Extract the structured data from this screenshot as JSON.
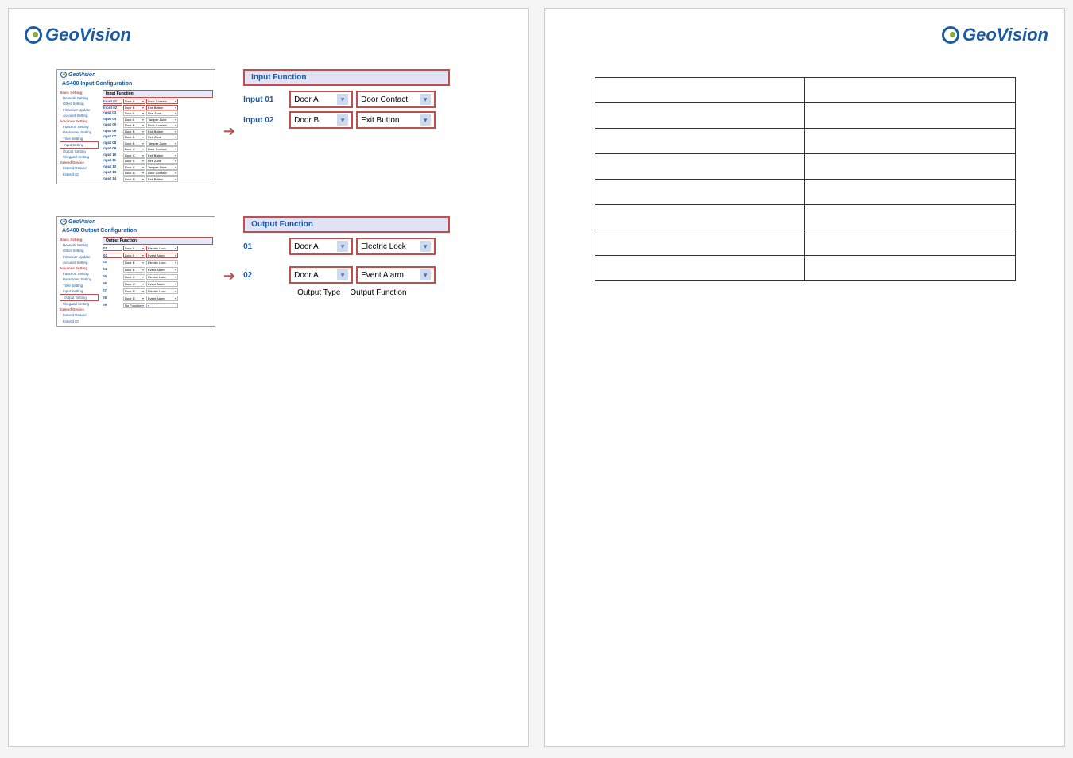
{
  "brand": "GeoVision",
  "input": {
    "mini_title": "AS400 Input Configuration",
    "panel_title": "Input Function",
    "rows": [
      {
        "n": "01",
        "door": "Door A",
        "fn": "Door Contact"
      },
      {
        "n": "02",
        "door": "Door B",
        "fn": "Exit Button"
      },
      {
        "n": "03",
        "door": "Door A",
        "fn": "Fire Zone"
      },
      {
        "n": "04",
        "door": "Door A",
        "fn": "Tamper Zone"
      },
      {
        "n": "05",
        "door": "Door B",
        "fn": "Door Contact"
      },
      {
        "n": "06",
        "door": "Door B",
        "fn": "Exit Button"
      },
      {
        "n": "07",
        "door": "Door B",
        "fn": "Fire Zone"
      },
      {
        "n": "08",
        "door": "Door B",
        "fn": "Tamper Zone"
      },
      {
        "n": "09",
        "door": "Door C",
        "fn": "Door Contact"
      },
      {
        "n": "10",
        "door": "Door C",
        "fn": "Exit Button"
      },
      {
        "n": "11",
        "door": "Door C",
        "fn": "Fire Zone"
      },
      {
        "n": "12",
        "door": "Door C",
        "fn": "Tamper Zone"
      },
      {
        "n": "13",
        "door": "Door D",
        "fn": "Door Contact"
      },
      {
        "n": "14",
        "door": "Door D",
        "fn": "Exit Button"
      }
    ],
    "enlarged": [
      {
        "label": "Input 01",
        "door": "Door A",
        "fn": "Door Contact"
      },
      {
        "label": "Input 02",
        "door": "Door B",
        "fn": "Exit Button"
      }
    ]
  },
  "output": {
    "mini_title": "AS400 Output Configuration",
    "panel_title": "Output Function",
    "rows": [
      {
        "n": "01",
        "door": "Door A",
        "fn": "Electric Lock"
      },
      {
        "n": "02",
        "door": "Door A",
        "fn": "Event Alarm"
      },
      {
        "n": "03",
        "door": "Door B",
        "fn": "Electric Lock"
      },
      {
        "n": "04",
        "door": "Door B",
        "fn": "Event Alarm"
      },
      {
        "n": "05",
        "door": "Door C",
        "fn": "Electric Lock"
      },
      {
        "n": "06",
        "door": "Door C",
        "fn": "Event Alarm"
      },
      {
        "n": "07",
        "door": "Door D",
        "fn": "Electric Lock"
      },
      {
        "n": "08",
        "door": "Door D",
        "fn": "Event Alarm"
      },
      {
        "n": "09",
        "door": "No Function",
        "fn": ""
      }
    ],
    "enlarged": [
      {
        "label": "01",
        "door": "Door A",
        "fn": "Electric Lock"
      },
      {
        "label": "02",
        "door": "Door A",
        "fn": "Event Alarm"
      }
    ],
    "caption1": "Output Type",
    "caption2": "Output Function"
  },
  "sidebar": {
    "basic": "Basic Setting",
    "items1": [
      "Network Setting",
      "Other Setting",
      "Firmware Update",
      "Account Setting"
    ],
    "advance": "Advance Setting",
    "items2": [
      "Function Setting",
      "Parameter Setting",
      "Time Setting",
      "Input Setting",
      "Output Setting",
      "Wiegand Setting"
    ],
    "extend": "Extend Device",
    "items3": [
      "Extend Reader",
      "Extend IO"
    ]
  }
}
